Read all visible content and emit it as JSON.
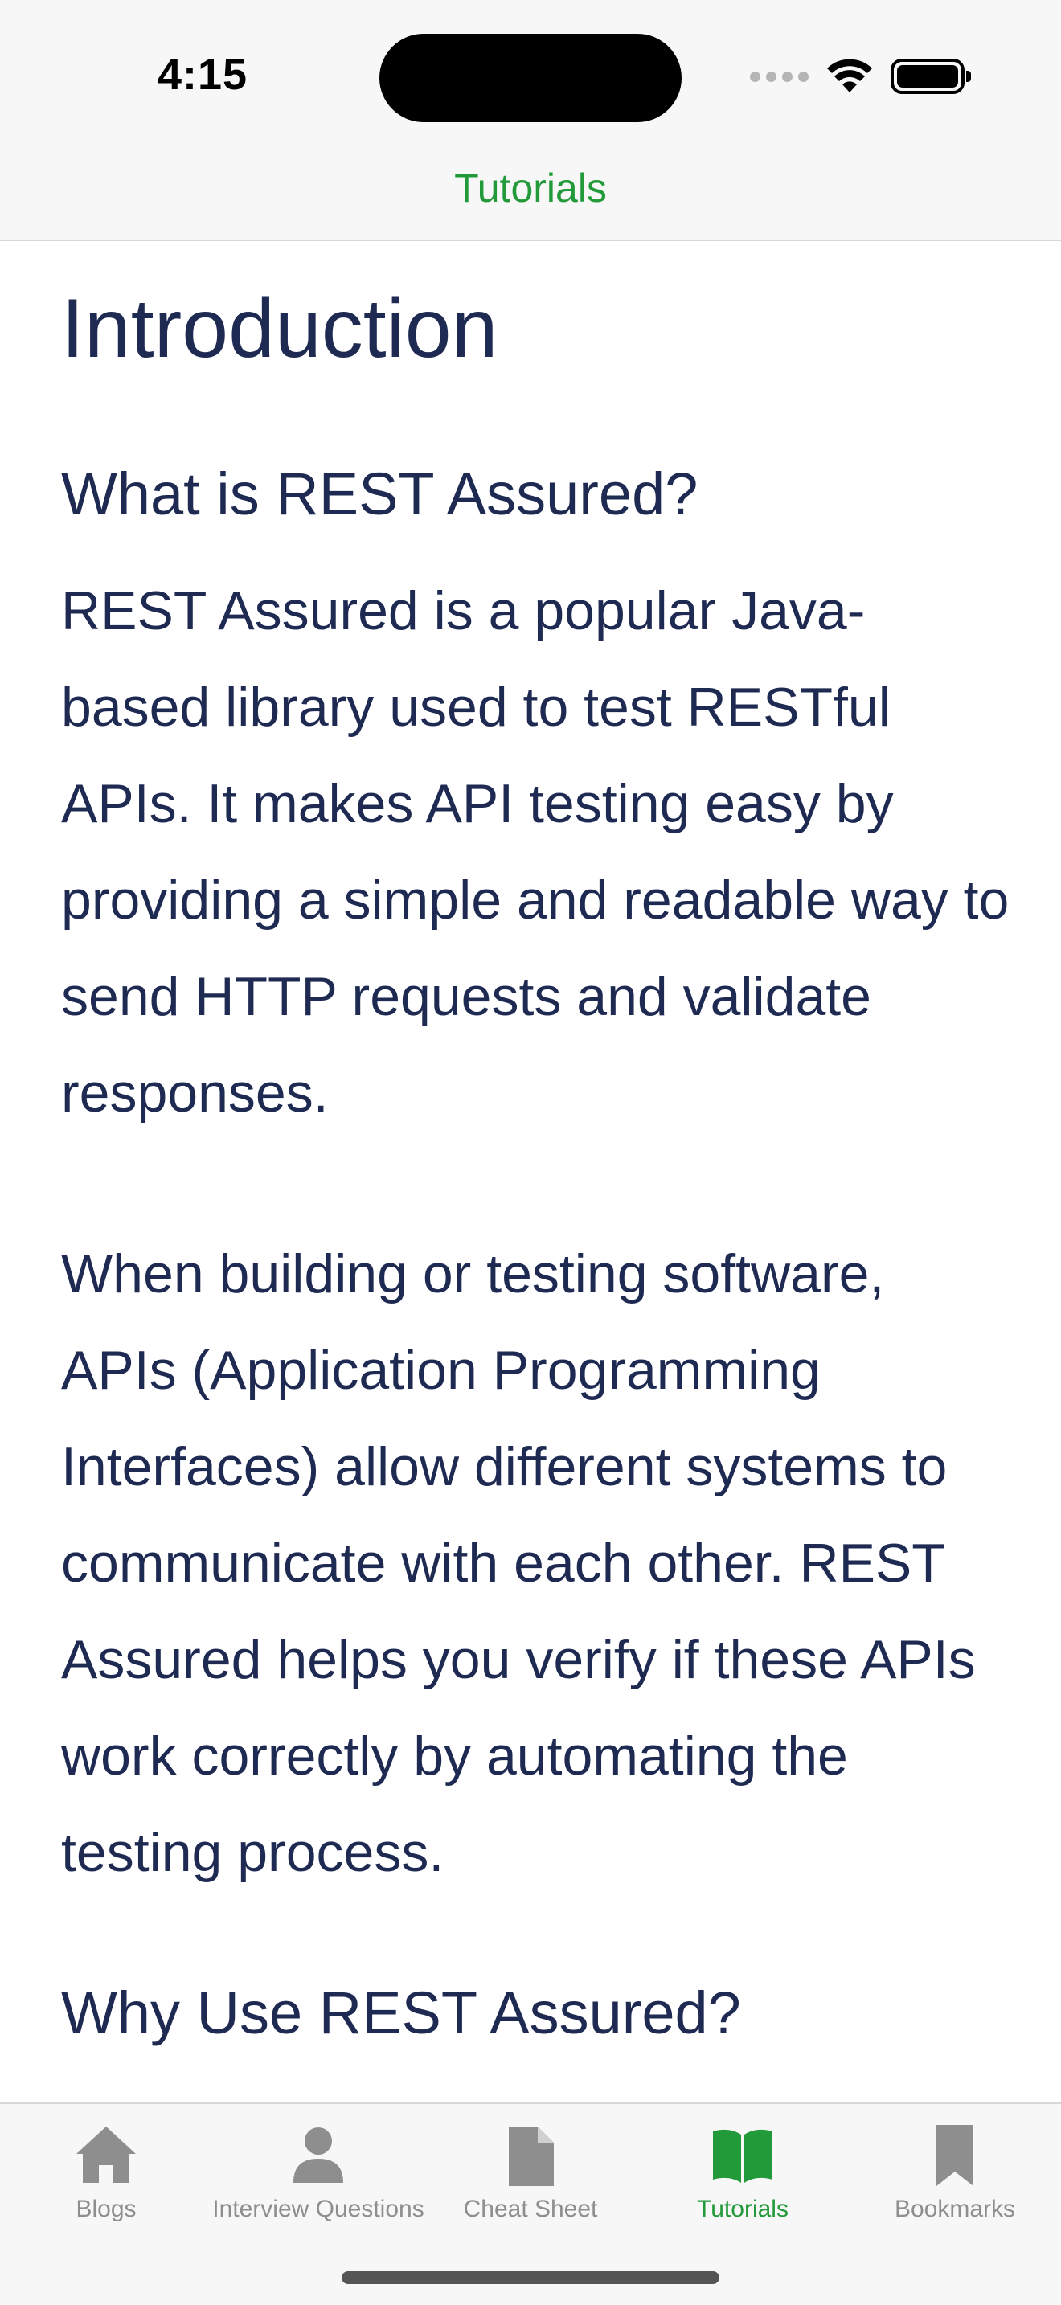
{
  "status_bar": {
    "time": "4:15"
  },
  "nav": {
    "title": "Tutorials"
  },
  "content": {
    "title": "Introduction",
    "section1_heading": "What is REST Assured?",
    "para1": "REST Assured is a popular Java-based library used to test RESTful APIs. It makes API testing easy by providing a simple and readable way to send HTTP requests and validate responses.",
    "para2": "When building or testing software, APIs (Application Programming Interfaces) allow different systems to communicate with each other. REST Assured helps you verify if these APIs work correctly by automating the testing process.",
    "section2_heading": "Why Use REST Assured?"
  },
  "tabbar": {
    "items": [
      {
        "label": "Blogs",
        "icon": "house-icon"
      },
      {
        "label": "Interview Questions",
        "icon": "person-icon"
      },
      {
        "label": "Cheat Sheet",
        "icon": "document-icon"
      },
      {
        "label": "Tutorials",
        "icon": "book-icon",
        "active": true
      },
      {
        "label": "Bookmarks",
        "icon": "bookmark-icon"
      }
    ]
  },
  "colors": {
    "accent": "#229a3a",
    "text": "#1e2a52",
    "inactive": "#8e8e8e"
  }
}
